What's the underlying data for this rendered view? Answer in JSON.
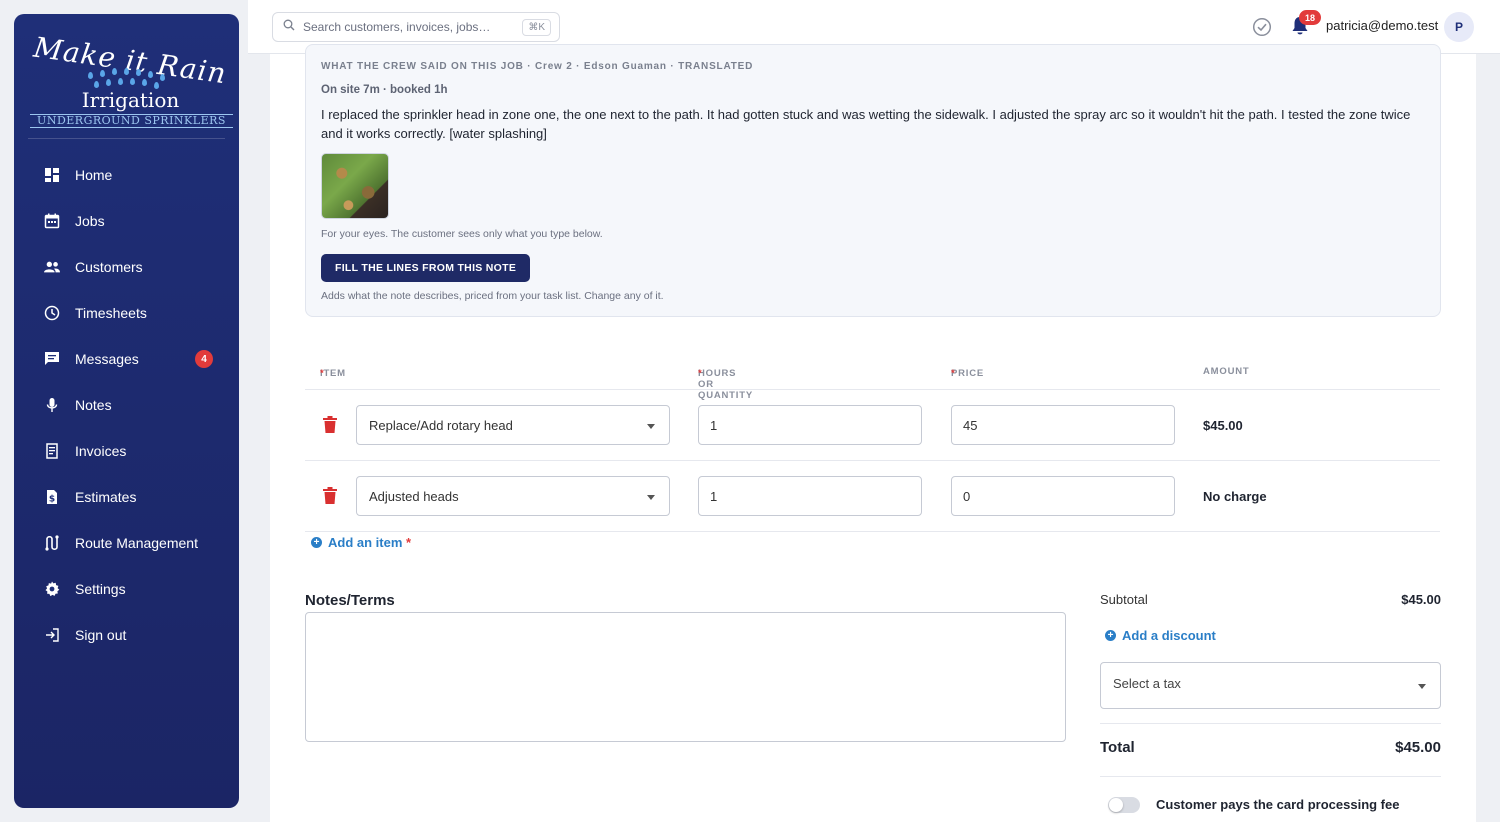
{
  "brand": {
    "line1": "Make it Rain",
    "line2": "Irrigation",
    "line3": "UNDERGROUND SPRINKLERS"
  },
  "sidebar": {
    "items": [
      {
        "label": "Home",
        "icon": "dashboard-icon"
      },
      {
        "label": "Jobs",
        "icon": "calendar-icon"
      },
      {
        "label": "Customers",
        "icon": "people-icon"
      },
      {
        "label": "Timesheets",
        "icon": "clock-icon"
      },
      {
        "label": "Messages",
        "icon": "chat-icon",
        "badge": "4"
      },
      {
        "label": "Notes",
        "icon": "microphone-icon"
      },
      {
        "label": "Invoices",
        "icon": "invoice-icon"
      },
      {
        "label": "Estimates",
        "icon": "estimate-icon"
      },
      {
        "label": "Route Management",
        "icon": "route-icon"
      },
      {
        "label": "Settings",
        "icon": "gear-icon"
      },
      {
        "label": "Sign out",
        "icon": "sign-out-icon"
      }
    ]
  },
  "topbar": {
    "search_placeholder": "Search customers, invoices, jobs…",
    "shortcut": "⌘K",
    "notifications_count": "18",
    "user_email": "patricia@demo.test",
    "avatar_initial": "P"
  },
  "crew_note": {
    "heading": "WHAT THE CREW SAID ON THIS JOB · Crew 2 · Edson Guaman · TRANSLATED",
    "meta": "On site 7m · booked 1h",
    "text": "I replaced the sprinkler head in zone one, the one next to the path. It had gotten stuck and was wetting the sidewalk. I adjusted the spray arc so it wouldn't hit the path. I tested the zone twice and it works correctly. [water splashing]",
    "private_hint": "For your eyes. The customer sees only what you type below.",
    "fill_button": "FILL THE LINES FROM THIS NOTE",
    "fill_hint": "Adds what the note describes, priced from your task list. Change any of it."
  },
  "line_items": {
    "headers": {
      "item": "ITEM",
      "qty": "HOURS OR QUANTITY",
      "price": "PRICE",
      "amount": "AMOUNT"
    },
    "required_mark": "*",
    "rows": [
      {
        "item": "Replace/Add rotary head",
        "qty": "1",
        "price": "45",
        "amount": "$45.00"
      },
      {
        "item": "Adjusted heads",
        "qty": "1",
        "price": "0",
        "amount": "No charge"
      }
    ],
    "add_label": "Add an item"
  },
  "notes_terms": {
    "title": "Notes/Terms",
    "value": ""
  },
  "totals": {
    "subtotal_label": "Subtotal",
    "subtotal_value": "$45.00",
    "add_discount": "Add a discount",
    "tax_placeholder": "Select a tax",
    "total_label": "Total",
    "total_value": "$45.00",
    "card_fee_label": "Customer pays the card processing fee",
    "card_fee_on": false
  },
  "colors": {
    "sidebar": "#1f2f78",
    "accent_blue": "#2a7ec7",
    "danger": "#e23b3b",
    "primary_button": "#1f2a66"
  }
}
